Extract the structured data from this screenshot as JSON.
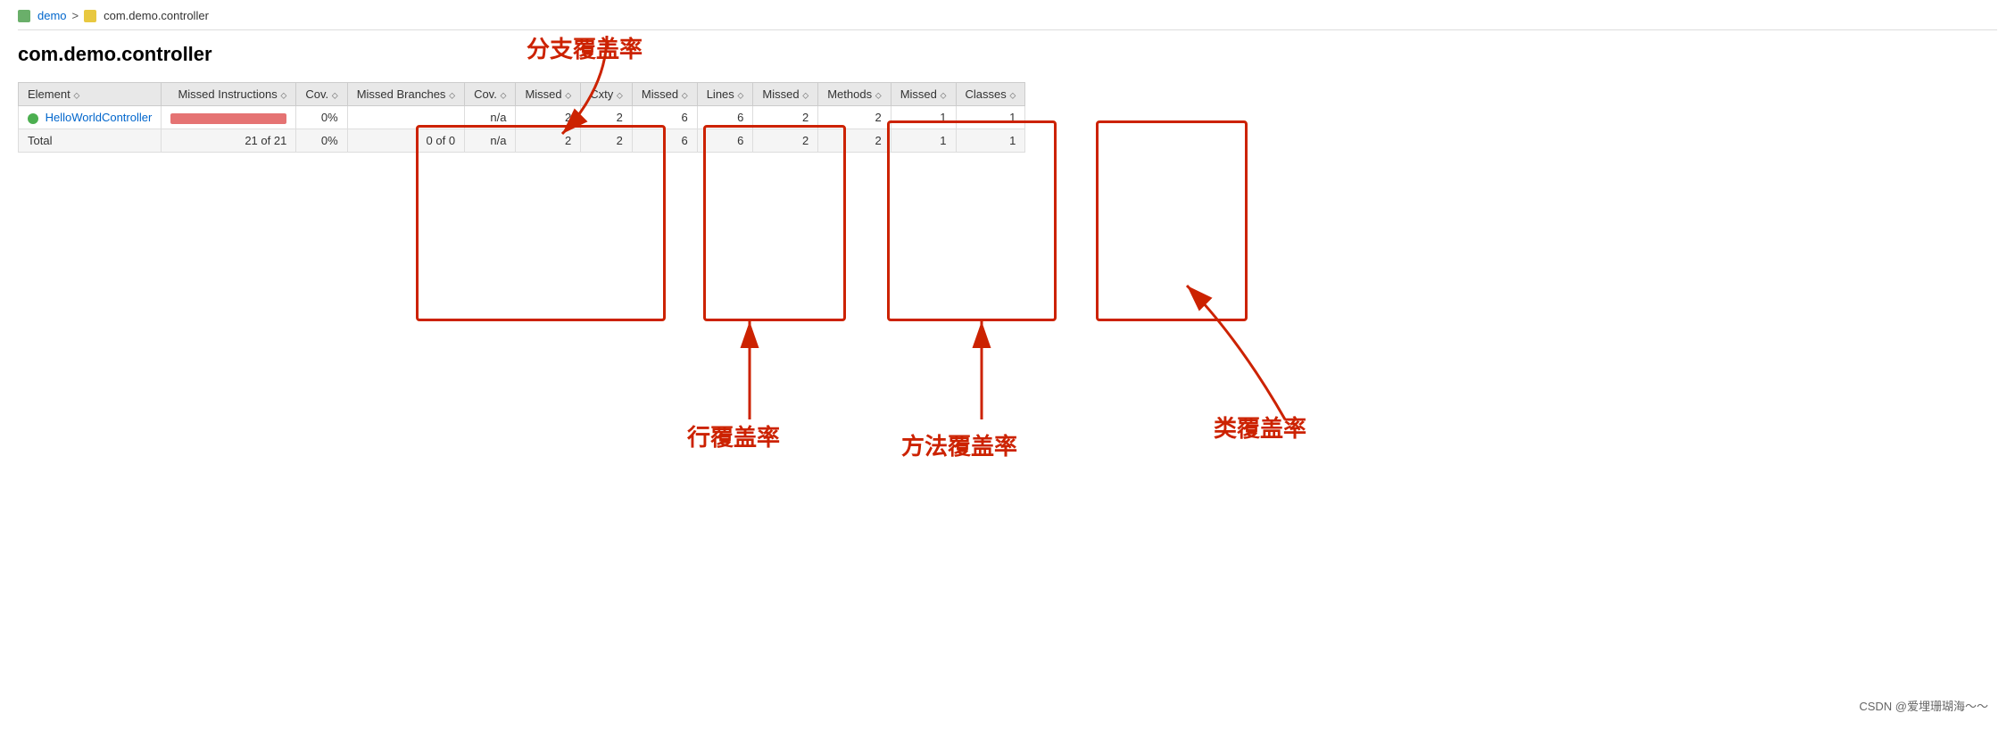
{
  "breadcrumb": {
    "link_label": "demo",
    "separator": ">",
    "current": "com.demo.controller"
  },
  "page_title": "com.demo.controller",
  "table": {
    "headers": [
      {
        "label": "Element",
        "sort": true
      },
      {
        "label": "Missed Instructions",
        "sort": true
      },
      {
        "label": "Cov.",
        "sort": true
      },
      {
        "label": "Missed Branches",
        "sort": true
      },
      {
        "label": "Cov.",
        "sort": true
      },
      {
        "label": "Missed",
        "sort": true
      },
      {
        "label": "Cxty",
        "sort": true
      },
      {
        "label": "Missed",
        "sort": true
      },
      {
        "label": "Lines",
        "sort": true
      },
      {
        "label": "Missed",
        "sort": true
      },
      {
        "label": "Methods",
        "sort": true
      },
      {
        "label": "Missed",
        "sort": true
      },
      {
        "label": "Classes",
        "sort": true
      }
    ],
    "rows": [
      {
        "element": "HelloWorldController",
        "is_link": true,
        "missed_instructions_bar": true,
        "missed_instructions_text": "",
        "cov": "0%",
        "missed_branches": "",
        "branches_cov": "n/a",
        "missed_cxty": "2",
        "cxty": "2",
        "missed_lines": "6",
        "lines": "6",
        "missed_methods": "2",
        "methods": "2",
        "missed_classes": "1",
        "classes": "1"
      },
      {
        "element": "Total",
        "is_link": false,
        "missed_instructions_bar": false,
        "missed_instructions_text": "21 of 21",
        "cov": "0%",
        "missed_branches": "0 of 0",
        "branches_cov": "n/a",
        "missed_cxty": "2",
        "cxty": "2",
        "missed_lines": "6",
        "lines": "6",
        "missed_methods": "2",
        "methods": "2",
        "missed_classes": "1",
        "classes": "1"
      }
    ]
  },
  "annotations": {
    "branch_coverage_label": "分支覆盖率",
    "line_coverage_label": "行覆盖率",
    "method_coverage_label": "方法覆盖率",
    "class_coverage_label": "类覆盖率"
  },
  "footer": {
    "text": "CSDN @爱埋珊瑚海～～"
  }
}
